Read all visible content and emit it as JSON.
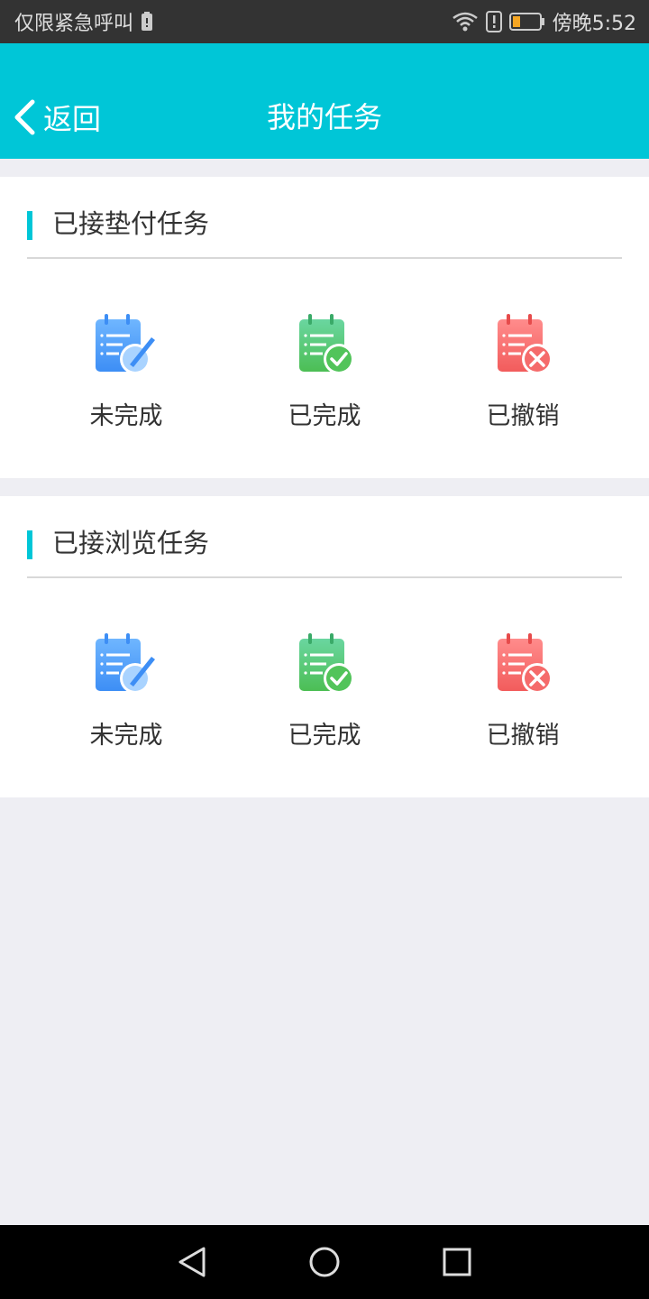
{
  "status_bar": {
    "left_text": "仅限紧急呼叫",
    "time": "傍晚5:52",
    "battery_color": "#f5a623"
  },
  "header": {
    "back_label": "返回",
    "title": "我的任务",
    "bg_color": "#00c6d7"
  },
  "sections": [
    {
      "title": "已接垫付任务",
      "items": [
        {
          "label": "未完成",
          "icon": "notepad-edit-icon",
          "color": "#4a9df8"
        },
        {
          "label": "已完成",
          "icon": "notepad-check-icon",
          "color": "#5ccf6a"
        },
        {
          "label": "已撤销",
          "icon": "notepad-cancel-icon",
          "color": "#f56b6b"
        }
      ]
    },
    {
      "title": "已接浏览任务",
      "items": [
        {
          "label": "未完成",
          "icon": "notepad-edit-icon",
          "color": "#4a9df8"
        },
        {
          "label": "已完成",
          "icon": "notepad-check-icon",
          "color": "#5ccf6a"
        },
        {
          "label": "已撤销",
          "icon": "notepad-cancel-icon",
          "color": "#f56b6b"
        }
      ]
    }
  ]
}
